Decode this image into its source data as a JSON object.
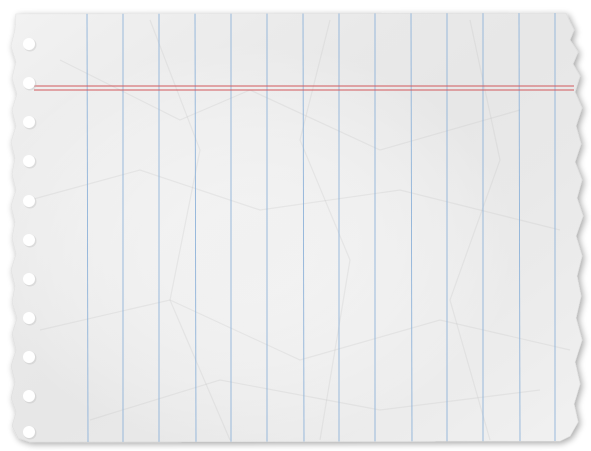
{
  "paper": {
    "kind": "torn-lined-notebook-sheet",
    "ruling": "vertical",
    "colors": {
      "paper": "#f4f4f4",
      "paper_shade": "#dedede",
      "rule_line": "#8fb3d9",
      "margin_line": "#d2585c",
      "punch_hole": "#ffffff",
      "shadow": "#b9b9b9"
    },
    "vertical_rule_count": 14,
    "margin_line_count": 2,
    "punch_hole_count": 11,
    "texture": "crumpled"
  }
}
